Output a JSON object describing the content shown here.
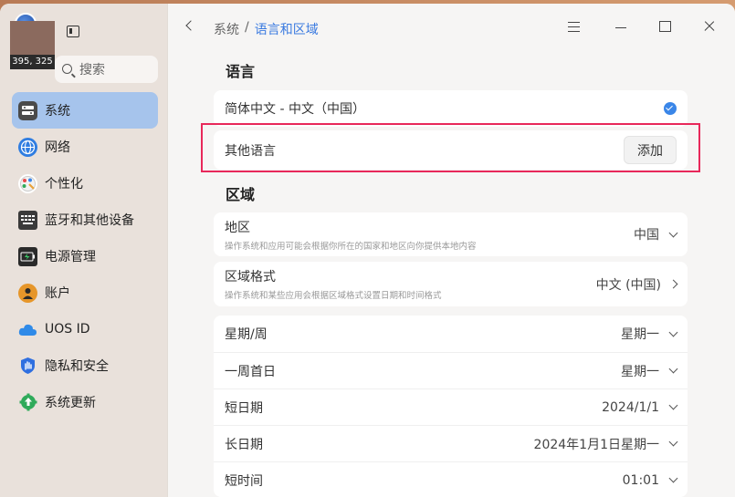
{
  "cursor": {
    "coords": "395, 325"
  },
  "sidebar": {
    "search_placeholder": "搜索",
    "items": [
      {
        "label": "系统",
        "icon": "system-icon",
        "color": "#4a4a4a"
      },
      {
        "label": "网络",
        "icon": "network-globe-icon",
        "color": "#2f7de1"
      },
      {
        "label": "个性化",
        "icon": "personalization-palette-icon",
        "color": "#e8a23a"
      },
      {
        "label": "蓝牙和其他设备",
        "icon": "keyboard-icon",
        "color": "#3a3a3a"
      },
      {
        "label": "电源管理",
        "icon": "power-battery-icon",
        "color": "#2f9a4e"
      },
      {
        "label": "账户",
        "icon": "account-icon",
        "color": "#e6962a"
      },
      {
        "label": "UOS ID",
        "icon": "cloud-icon",
        "color": "#2f8ae8"
      },
      {
        "label": "隐私和安全",
        "icon": "privacy-shield-icon",
        "color": "#2f6fe0"
      },
      {
        "label": "系统更新",
        "icon": "update-gear-icon",
        "color": "#2faa5a"
      }
    ]
  },
  "header": {
    "breadcrumb_parent": "系统",
    "breadcrumb_sep": "/",
    "breadcrumb_current": "语言和区域"
  },
  "language": {
    "title": "语言",
    "current": "简体中文 - 中文（中国）",
    "other_label": "其他语言",
    "add_label": "添加"
  },
  "region": {
    "title": "区域",
    "area_label": "地区",
    "area_desc": "操作系统和应用可能会根据你所在的国家和地区向你提供本地内容",
    "area_value": "中国",
    "format_label": "区域格式",
    "format_desc": "操作系统和某些应用会根据区域格式设置日期和时间格式",
    "format_value": "中文 (中国)"
  },
  "formats": [
    {
      "label": "星期/周",
      "value": "星期一"
    },
    {
      "label": "一周首日",
      "value": "星期一"
    },
    {
      "label": "短日期",
      "value": "2024/1/1"
    },
    {
      "label": "长日期",
      "value": "2024年1月1日星期一"
    },
    {
      "label": "短时间",
      "value": "01:01"
    }
  ],
  "accent_color": "#3a7ae0",
  "highlight_color": "#e8285a"
}
